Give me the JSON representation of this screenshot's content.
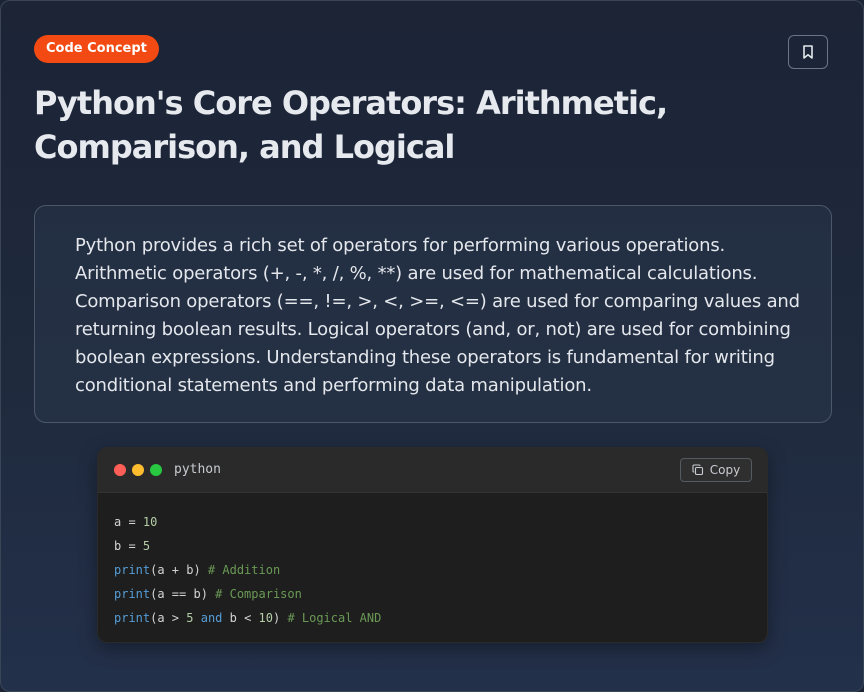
{
  "badge": {
    "label": "Code Concept"
  },
  "title": "Python's Core Operators: Arithmetic, Comparison, and Logical",
  "description": "Python provides a rich set of operators for performing various operations. Arithmetic operators (+, -, *, /, %, **) are used for mathematical calculations. Comparison operators (==, !=, >, <, >=, <=) are used for comparing values and returning boolean results. Logical operators (and, or, not) are used for combining boolean expressions. Understanding these operators is fundamental for writing conditional statements and performing data manipulation.",
  "code": {
    "language": "python",
    "copy_label": "Copy",
    "lines": [
      [
        {
          "t": "a = ",
          "c": "plain"
        },
        {
          "t": "10",
          "c": "num"
        }
      ],
      [
        {
          "t": "b = ",
          "c": "plain"
        },
        {
          "t": "5",
          "c": "num"
        }
      ],
      [
        {
          "t": "print",
          "c": "fn"
        },
        {
          "t": "(a + b) ",
          "c": "plain"
        },
        {
          "t": "# Addition",
          "c": "cm"
        }
      ],
      [
        {
          "t": "print",
          "c": "fn"
        },
        {
          "t": "(a == b) ",
          "c": "plain"
        },
        {
          "t": "# Comparison",
          "c": "cm"
        }
      ],
      [
        {
          "t": "print",
          "c": "fn"
        },
        {
          "t": "(a > ",
          "c": "plain"
        },
        {
          "t": "5",
          "c": "num"
        },
        {
          "t": " ",
          "c": "plain"
        },
        {
          "t": "and",
          "c": "kw"
        },
        {
          "t": " b < ",
          "c": "plain"
        },
        {
          "t": "10",
          "c": "num"
        },
        {
          "t": ") ",
          "c": "plain"
        },
        {
          "t": "# Logical AND",
          "c": "cm"
        }
      ]
    ]
  },
  "colors": {
    "badge_bg": "#f24a12",
    "code_function": "#569cd6",
    "code_number": "#b5cea8",
    "code_comment": "#6a9955"
  },
  "icons": {
    "bookmark": "bookmark-icon",
    "copy": "copy-icon"
  }
}
